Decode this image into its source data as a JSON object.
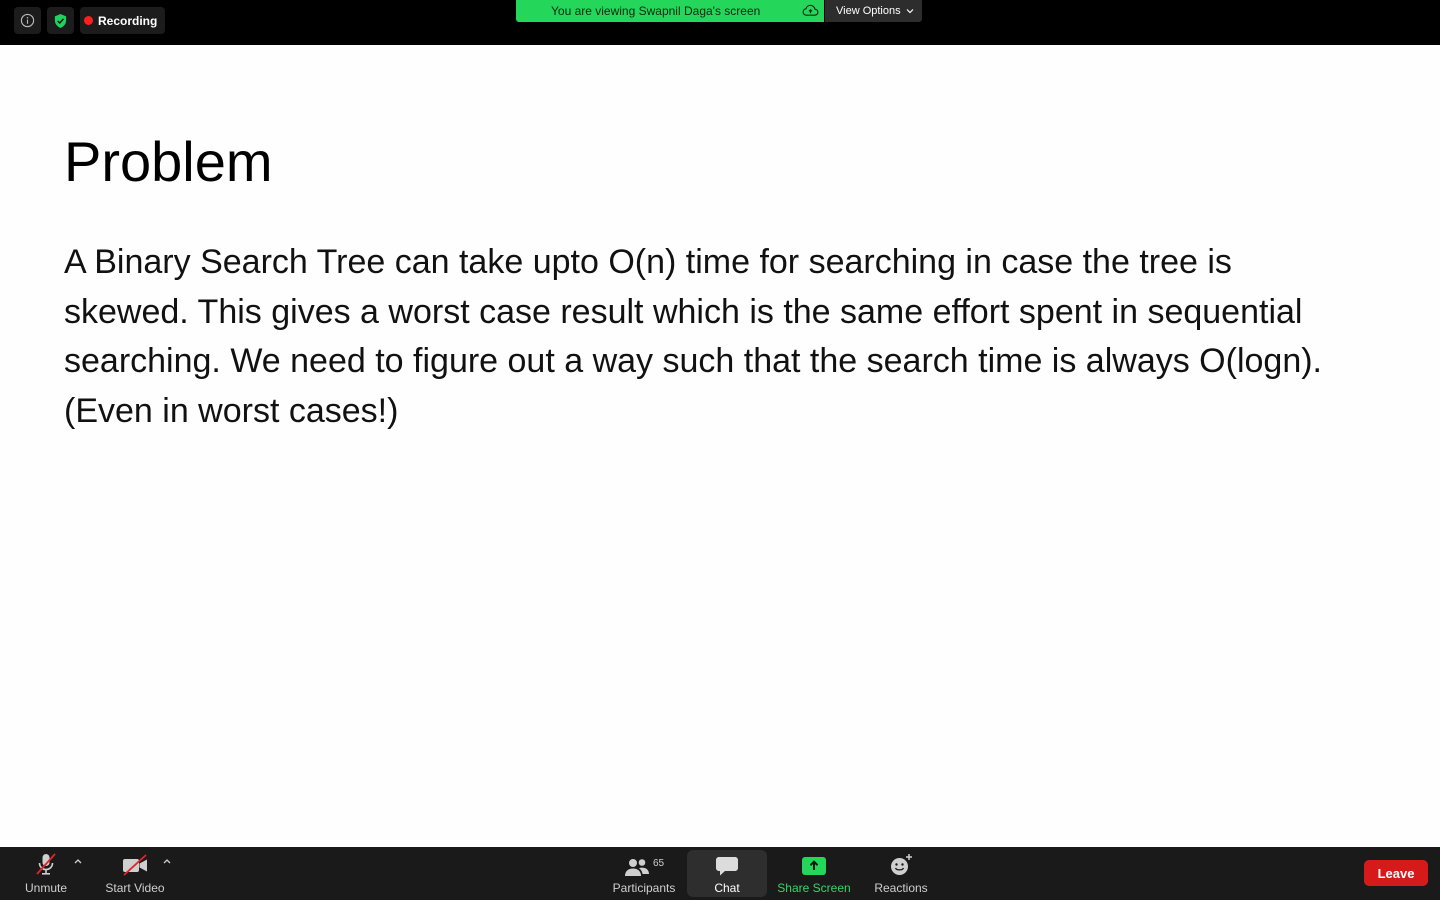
{
  "topbar": {
    "recording_label": "Recording",
    "viewing_text": "You are viewing Swapnil Daga's screen",
    "view_options_label": "View Options"
  },
  "slide": {
    "title": "Problem",
    "body": "A Binary Search Tree can take upto O(n) time for searching in case the tree is skewed. This gives a worst case result which is the same effort spent in sequential searching. We need to figure out a way such that the search time is always O(logn). (Even in worst cases!)"
  },
  "controls": {
    "unmute_label": "Unmute",
    "start_video_label": "Start Video",
    "participants_label": "Participants",
    "participants_count": "65",
    "chat_label": "Chat",
    "share_screen_label": "Share Screen",
    "reactions_label": "Reactions",
    "leave_label": "Leave"
  },
  "colors": {
    "share_green": "#24d65a",
    "recording_red": "#ff1e1e",
    "leave_red": "#d61a1a"
  },
  "icons": [
    "info-icon",
    "shield-check-icon",
    "cloud-icon",
    "chevron-down-icon",
    "microphone-muted-icon",
    "video-off-icon",
    "participants-icon",
    "chat-icon",
    "share-screen-icon",
    "reactions-icon"
  ]
}
